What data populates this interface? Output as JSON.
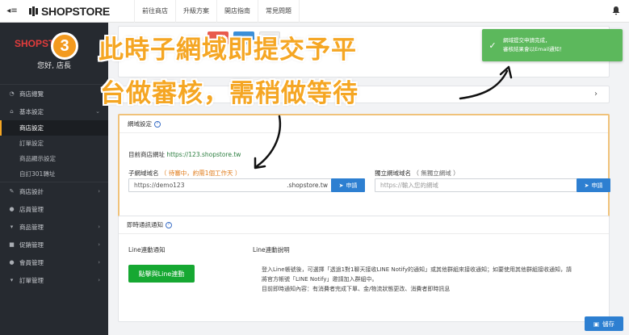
{
  "topbar": {
    "brand": "SHOPSTORE",
    "nav": [
      "前往商店",
      "升級方案",
      "開店指南",
      "常見問題"
    ]
  },
  "sidebar": {
    "brand": "SHOPSTORE",
    "greeting": "您好, 店長",
    "items": [
      {
        "label": "商店總覽",
        "icon": "dashboard-icon"
      },
      {
        "label": "基本設定",
        "icon": "bank-icon",
        "expanded": true
      },
      {
        "label": "商店設定",
        "sub": true,
        "active": true
      },
      {
        "label": "訂單設定",
        "sub": true
      },
      {
        "label": "商品顯示設定",
        "sub": true
      },
      {
        "label": "自訂301轉址",
        "sub": true
      },
      {
        "label": "商店設計",
        "icon": "brush-icon"
      },
      {
        "label": "店員管理",
        "icon": "user-icon"
      },
      {
        "label": "商品管理",
        "icon": "cart-icon"
      },
      {
        "label": "促銷管理",
        "icon": "gift-icon"
      },
      {
        "label": "會員管理",
        "icon": "users-icon"
      },
      {
        "label": "訂單管理",
        "icon": "cart-icon"
      }
    ]
  },
  "domain": {
    "title": "網域設定",
    "current_label": "目前商店網址",
    "current_url": "https://123.shopstore.tw",
    "sub_label": "子網域域名",
    "sub_note": "（ 待審中，約需1個工作天 ）",
    "sub_value": "https://demo123",
    "sub_suffix": ".shopstore.tw",
    "own_label": "獨立網域域名",
    "own_note": "（ 無獨立網域 ）",
    "own_placeholder": "https://輸入您的網域",
    "apply": "申請"
  },
  "notify": {
    "title": "即時通訊通知",
    "line_label": "Line連動通知",
    "line_button": "點擊與Line連動",
    "desc_title": "Line連動說明",
    "desc_lines": [
      "登入Line帳號後，可選擇「透過1對1聊天接收LINE Notify的通知」或其他群組來接收通知；如要使用其他群組接收通知，請",
      "將官方帳號「LINE Notify」邀請加入群組中。",
      "目前即時通知內容：有消費者完成下單、金/物流狀態更改、消費者即時訊息"
    ]
  },
  "save": "儲存",
  "toast": {
    "line1": "網域提交申請完成，",
    "line2": "審核結果會以Email通知！"
  },
  "annotation": {
    "step": "3",
    "line1": "此時子網域即提交予平",
    "line2": "台做審核，需稍做等待"
  },
  "colors": {
    "accent": "#f5a623",
    "primary": "#2d7fd1",
    "success": "#5cb85c",
    "line_green": "#16a832",
    "sidebar_bg": "#262a30"
  }
}
